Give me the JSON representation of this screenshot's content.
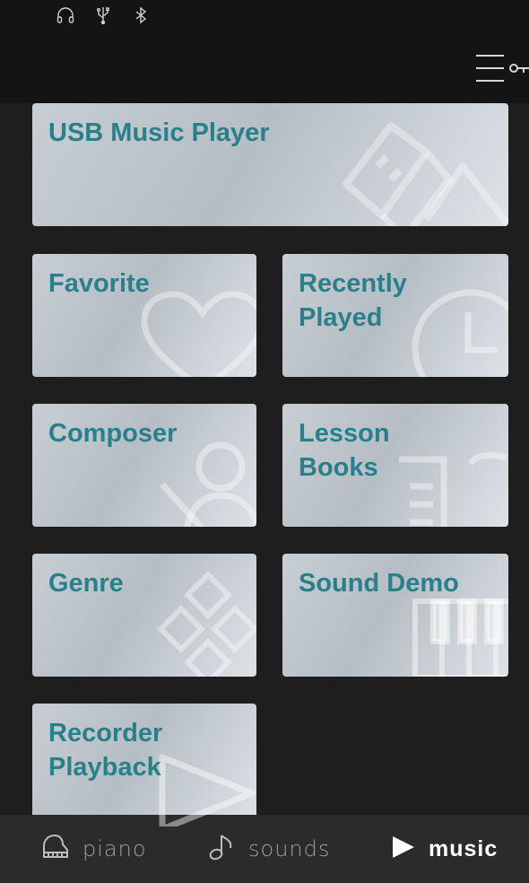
{
  "status_icons": [
    "headphones-icon",
    "usb-icon",
    "bluetooth-icon"
  ],
  "menu": {
    "icon": "hamburger-key-icon"
  },
  "tiles": [
    {
      "label": "USB Music Player",
      "icon": "usb-drive-icon"
    },
    {
      "label": "Favorite",
      "icon": "heart-icon"
    },
    {
      "label": "Recently\nPlayed",
      "icon": "clock-icon"
    },
    {
      "label": "Composer",
      "icon": "composer-icon"
    },
    {
      "label": "Lesson\nBooks",
      "icon": "book-icon"
    },
    {
      "label": "Genre",
      "icon": "genre-grid-icon"
    },
    {
      "label": "Sound Demo",
      "icon": "piano-keys-icon"
    },
    {
      "label": "Recorder\nPlayback",
      "icon": "play-icon"
    }
  ],
  "bottom_nav": [
    {
      "label": "piano",
      "icon": "grand-piano-icon",
      "active": false
    },
    {
      "label": "sounds",
      "icon": "music-note-icon",
      "active": false
    },
    {
      "label": "music",
      "icon": "play-triangle-icon",
      "active": true
    }
  ],
  "colors": {
    "background": "#1e1e1e",
    "bar": "#141414",
    "tile_label": "#2a7f8c",
    "nav_active": "#ffffff",
    "nav_inactive": "#9e9e9e"
  }
}
